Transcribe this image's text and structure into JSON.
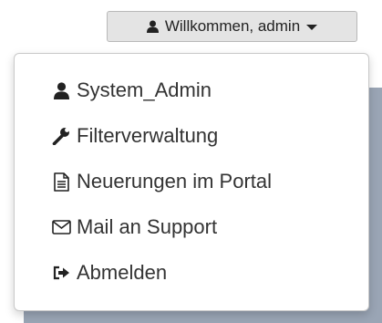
{
  "header": {
    "user_toggle": {
      "label": "Willkommen, admin",
      "icon": "user-icon"
    }
  },
  "menu": {
    "items": [
      {
        "label": "System_Admin",
        "icon": "user-icon"
      },
      {
        "label": "Filterverwaltung",
        "icon": "wrench-icon"
      },
      {
        "label": "Neuerungen im Portal",
        "icon": "file-text-icon"
      },
      {
        "label": "Mail an Support",
        "icon": "envelope-icon"
      },
      {
        "label": "Abmelden",
        "icon": "sign-out-icon"
      }
    ]
  },
  "colors": {
    "backdrop": "#9aa5b5",
    "button_bg": "#e4e4e4",
    "text": "#333333"
  }
}
